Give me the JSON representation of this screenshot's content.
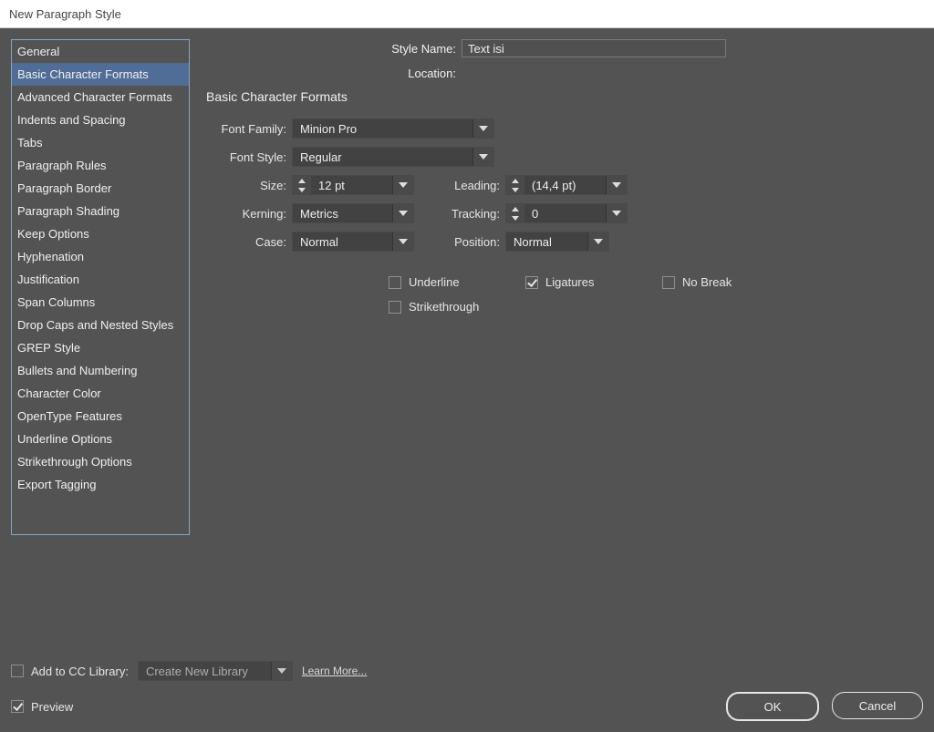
{
  "title": "New Paragraph Style",
  "sidebar": {
    "items": [
      "General",
      "Basic Character Formats",
      "Advanced Character Formats",
      "Indents and Spacing",
      "Tabs",
      "Paragraph Rules",
      "Paragraph Border",
      "Paragraph Shading",
      "Keep Options",
      "Hyphenation",
      "Justification",
      "Span Columns",
      "Drop Caps and Nested Styles",
      "GREP Style",
      "Bullets and Numbering",
      "Character Color",
      "OpenType Features",
      "Underline Options",
      "Strikethrough Options",
      "Export Tagging"
    ],
    "selected_index": 1
  },
  "header": {
    "style_name_label": "Style Name:",
    "style_name_value": "Text isi",
    "location_label": "Location:"
  },
  "panel": {
    "title": "Basic Character Formats",
    "font_family_label": "Font Family:",
    "font_family_value": "Minion Pro",
    "font_style_label": "Font Style:",
    "font_style_value": "Regular",
    "size_label": "Size:",
    "size_value": "12 pt",
    "leading_label": "Leading:",
    "leading_value": "(14,4 pt)",
    "kerning_label": "Kerning:",
    "kerning_value": "Metrics",
    "tracking_label": "Tracking:",
    "tracking_value": "0",
    "case_label": "Case:",
    "case_value": "Normal",
    "position_label": "Position:",
    "position_value": "Normal",
    "checks": {
      "underline": {
        "label": "Underline",
        "checked": false
      },
      "ligatures": {
        "label": "Ligatures",
        "checked": true
      },
      "no_break": {
        "label": "No Break",
        "checked": false
      },
      "strikethrough": {
        "label": "Strikethrough",
        "checked": false
      }
    }
  },
  "footer": {
    "add_cc_label": "Add to CC Library:",
    "add_cc_checked": false,
    "cc_combo_value": "Create New Library",
    "learn_more": "Learn More...",
    "preview_label": "Preview",
    "preview_checked": true,
    "ok": "OK",
    "cancel": "Cancel"
  }
}
